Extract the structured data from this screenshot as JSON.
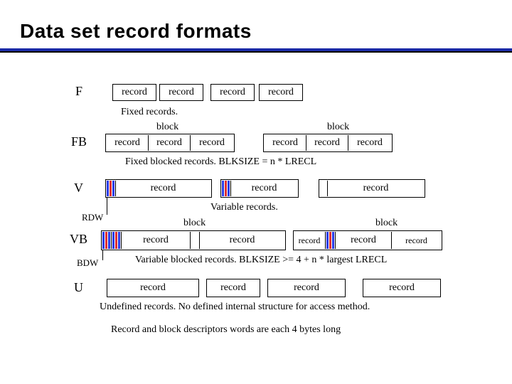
{
  "title": "Data set record formats",
  "labels": {
    "F": "F",
    "FB": "FB",
    "V": "V",
    "VB": "VB",
    "U": "U",
    "RDW": "RDW",
    "BDW": "BDW",
    "block": "block",
    "record": "record"
  },
  "captions": {
    "fixed": "Fixed records.",
    "fixed_blocked": "Fixed blocked records.  BLKSIZE = n * LRECL",
    "variable": "Variable records.",
    "variable_blocked": "Variable blocked records.  BLKSIZE >= 4 + n * largest LRECL",
    "undefined": "Undefined records.  No defined internal structure for access method.",
    "footnote": "Record and block descriptors words are each 4 bytes long"
  }
}
